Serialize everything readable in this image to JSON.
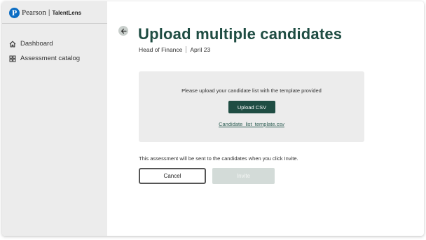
{
  "brand": {
    "logo_letter": "P",
    "name": "Pearson",
    "separator": "|",
    "product": "TalentLens"
  },
  "sidebar": {
    "items": [
      {
        "label": "Dashboard",
        "icon": "home-icon"
      },
      {
        "label": "Assessment catalog",
        "icon": "catalog-grid-icon"
      }
    ]
  },
  "header": {
    "title": "Upload multiple candidates",
    "role": "Head of Finance",
    "date": "April 23"
  },
  "upload": {
    "message": "Please upload your candidate list with the template provided",
    "button_label": "Upload CSV",
    "template_link": "Candidate_list_template.csv"
  },
  "footer": {
    "info": "This assessment will be sent to the candidates when you click Invite.",
    "cancel_label": "Cancel",
    "invite_label": "Invite"
  },
  "colors": {
    "accent": "#1f4d43",
    "sidebar_bg": "#ececec",
    "panel_bg": "#ececec",
    "brand_blue": "#0b6dc4",
    "disabled": "#d3dbd8"
  }
}
